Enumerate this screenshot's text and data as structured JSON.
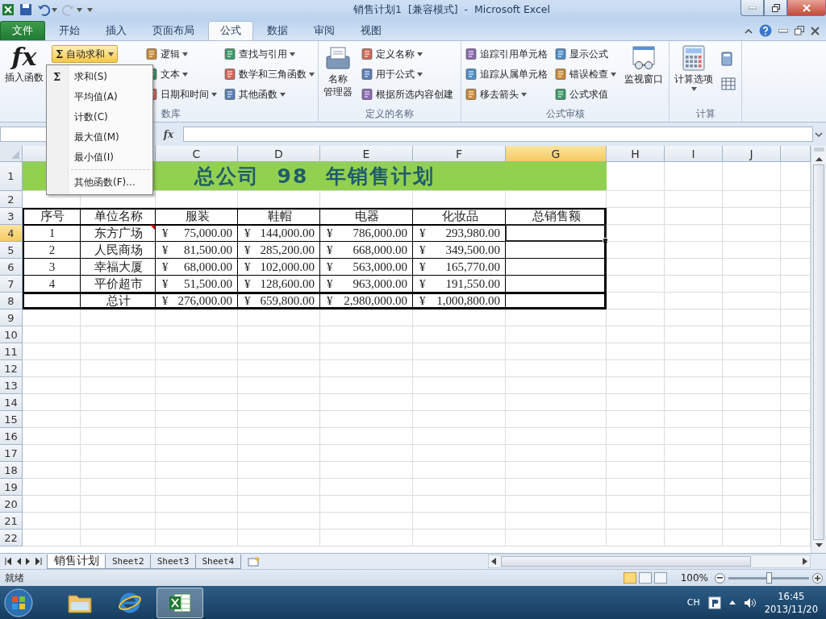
{
  "title_bar": {
    "title": "销售计划1  [兼容模式]  -  Microsoft Excel",
    "quick_access": [
      {
        "kind": "save",
        "disabled": false
      },
      {
        "kind": "undo",
        "disabled": false
      },
      {
        "kind": "redo",
        "disabled": true
      }
    ]
  },
  "ribbon_tabs": [
    {
      "label": "文件",
      "kind": "file",
      "selected": false
    },
    {
      "label": "开始",
      "kind": "tab",
      "selected": false
    },
    {
      "label": "插入",
      "kind": "tab",
      "selected": false
    },
    {
      "label": "页面布局",
      "kind": "tab",
      "selected": false
    },
    {
      "label": "公式",
      "kind": "tab",
      "selected": true
    },
    {
      "label": "数据",
      "kind": "tab",
      "selected": false
    },
    {
      "label": "审阅",
      "kind": "tab",
      "selected": false
    },
    {
      "label": "视图",
      "kind": "tab",
      "selected": false
    }
  ],
  "ribbon_groups": [
    {
      "title": "数库",
      "controls": [
        {
          "kind": "large",
          "glyph": "fx",
          "lines": [
            "插入函数"
          ],
          "menu": false
        },
        {
          "kind": "split",
          "glyph": "Σ",
          "label": "自动求和",
          "open": true
        },
        {
          "kind": "column",
          "items": [
            {
              "label": "逻辑",
              "menu": true
            },
            {
              "label": "文本",
              "menu": true
            },
            {
              "label": "日期和时间",
              "menu": true
            }
          ]
        },
        {
          "kind": "column",
          "items": [
            {
              "label": "查找与引用",
              "menu": true
            },
            {
              "label": "数学和三角函数",
              "menu": true
            },
            {
              "label": "其他函数",
              "menu": true
            }
          ]
        }
      ]
    },
    {
      "title": "定义的名称",
      "controls": [
        {
          "kind": "large",
          "lines": [
            "名称",
            "管理器"
          ],
          "menu": false
        },
        {
          "kind": "column",
          "items": [
            {
              "label": "定义名称",
              "menu": true
            },
            {
              "label": "用于公式",
              "menu": true
            },
            {
              "label": "根据所选内容创建",
              "menu": false
            }
          ]
        }
      ]
    },
    {
      "title": "公式审核",
      "controls": [
        {
          "kind": "column",
          "items": [
            {
              "label": "追踪引用单元格",
              "menu": false
            },
            {
              "label": "追踪从属单元格",
              "menu": false
            },
            {
              "label": "移去箭头",
              "menu": true
            }
          ]
        },
        {
          "kind": "column",
          "items": [
            {
              "label": "显示公式",
              "menu": false
            },
            {
              "label": "错误检查",
              "menu": true
            },
            {
              "label": "公式求值",
              "menu": false
            }
          ]
        },
        {
          "kind": "large",
          "lines": [
            "监视窗口"
          ],
          "menu": false
        }
      ]
    },
    {
      "title": "计算",
      "controls": [
        {
          "kind": "large",
          "lines": [
            "计算选项"
          ],
          "menu": true
        },
        {
          "kind": "icons"
        }
      ]
    }
  ],
  "autosum_menu": [
    {
      "kind": "item",
      "glyph": "Σ",
      "label": "求和(S)"
    },
    {
      "kind": "item",
      "label": "平均值(A)"
    },
    {
      "kind": "item",
      "label": "计数(C)"
    },
    {
      "kind": "item",
      "label": "最大值(M)"
    },
    {
      "kind": "item",
      "label": "最小值(I)"
    },
    {
      "kind": "separator"
    },
    {
      "kind": "item",
      "label": "其他函数(F)..."
    }
  ],
  "formula_bar": {
    "fx": "fx"
  },
  "sheet": {
    "columns": [
      {
        "selected": false
      },
      {
        "selected": false
      },
      {
        "label": "C",
        "selected": false
      },
      {
        "label": "D",
        "selected": false
      },
      {
        "label": "E",
        "selected": false
      },
      {
        "label": "F",
        "selected": false
      },
      {
        "label": "G",
        "selected": true
      },
      {
        "label": "H",
        "selected": false
      },
      {
        "label": "I",
        "selected": false
      },
      {
        "label": "J",
        "selected": false
      },
      {
        "selected": false
      }
    ],
    "rows": [
      {
        "label": "1",
        "selected": false
      },
      {
        "label": "2",
        "selected": false
      },
      {
        "label": "3",
        "selected": false
      },
      {
        "label": "4",
        "selected": true
      },
      {
        "label": "5",
        "selected": false
      },
      {
        "label": "6",
        "selected": false
      },
      {
        "label": "7",
        "selected": false
      },
      {
        "label": "8",
        "selected": false
      },
      {
        "label": "9",
        "selected": false
      },
      {
        "label": "10",
        "selected": false
      },
      {
        "label": "11",
        "selected": false
      },
      {
        "label": "12",
        "selected": false
      },
      {
        "label": "13",
        "selected": false
      },
      {
        "label": "14",
        "selected": false
      },
      {
        "label": "15",
        "selected": false
      },
      {
        "label": "16",
        "selected": false
      },
      {
        "label": "17",
        "selected": false
      },
      {
        "label": "18",
        "selected": false
      },
      {
        "label": "19",
        "selected": false
      },
      {
        "label": "20",
        "selected": false
      },
      {
        "label": "21",
        "selected": false
      },
      {
        "label": "22",
        "selected": false
      }
    ],
    "title": "总公司  98  年销售计划",
    "table": {
      "header": [
        "序号",
        "单位名称",
        "服装",
        "鞋帽",
        "电器",
        "化妆品",
        "总销售额"
      ],
      "rows": [
        {
          "index": "1",
          "unit": "东方广场",
          "comment": true,
          "amounts": [
            {
              "currency": "¥",
              "value": "75,000.00"
            },
            {
              "currency": "¥",
              "value": "144,000.00"
            },
            {
              "currency": "¥",
              "value": "786,000.00"
            },
            {
              "currency": "¥",
              "value": "293,980.00"
            }
          ]
        },
        {
          "index": "2",
          "unit": "人民商场",
          "comment": false,
          "amounts": [
            {
              "currency": "¥",
              "value": "81,500.00"
            },
            {
              "currency": "¥",
              "value": "285,200.00"
            },
            {
              "currency": "¥",
              "value": "668,000.00"
            },
            {
              "currency": "¥",
              "value": "349,500.00"
            }
          ]
        },
        {
          "index": "3",
          "unit": "幸福大厦",
          "comment": false,
          "amounts": [
            {
              "currency": "¥",
              "value": "68,000.00"
            },
            {
              "currency": "¥",
              "value": "102,000.00"
            },
            {
              "currency": "¥",
              "value": "563,000.00"
            },
            {
              "currency": "¥",
              "value": "165,770.00"
            }
          ]
        },
        {
          "index": "4",
          "unit": "平价超市",
          "comment": false,
          "amounts": [
            {
              "currency": "¥",
              "value": "51,500.00"
            },
            {
              "currency": "¥",
              "value": "128,600.00"
            },
            {
              "currency": "¥",
              "value": "963,000.00"
            },
            {
              "currency": "¥",
              "value": "191,550.00"
            }
          ]
        }
      ],
      "total": {
        "label": "总计",
        "amounts": [
          {
            "currency": "¥",
            "value": "276,000.00"
          },
          {
            "currency": "¥",
            "value": "659,800.00"
          },
          {
            "currency": "¥",
            "value": "2,980,000.00"
          },
          {
            "currency": "¥",
            "value": "1,000,800.00"
          }
        ]
      }
    }
  },
  "sheet_tabs": [
    {
      "label": "销售计划",
      "selected": true
    },
    {
      "label": "Sheet2",
      "selected": false
    },
    {
      "label": "Sheet3",
      "selected": false
    },
    {
      "label": "Sheet4",
      "selected": false
    }
  ],
  "status_bar": {
    "status": "就绪",
    "views": [
      {
        "selected": true
      },
      {
        "selected": false
      },
      {
        "selected": false
      }
    ],
    "zoom": "100%",
    "zoom_slider": {
      "level": 0.5
    }
  },
  "taskbar": {
    "apps": [
      {
        "kind": "folder",
        "active": false
      },
      {
        "kind": "browser",
        "active": false
      },
      {
        "kind": "spreadsheet",
        "active": true
      }
    ],
    "language": "CH",
    "time": "16:45",
    "date": "2013/11/20"
  }
}
